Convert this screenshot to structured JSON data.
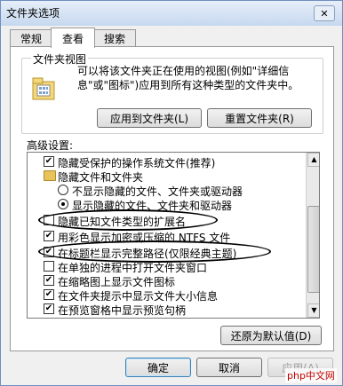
{
  "window": {
    "title": "文件夹选项",
    "close_icon": "close-icon"
  },
  "tabs": [
    {
      "label": "常规",
      "active": false
    },
    {
      "label": "查看",
      "active": true
    },
    {
      "label": "搜索",
      "active": false
    }
  ],
  "folder_views": {
    "title": "文件夹视图",
    "description": "可以将该文件夹正在使用的视图(例如\"详细信息\"或\"图标\")应用到所有这种类型的文件夹中。",
    "apply_button": "应用到文件夹(L)",
    "reset_button": "重置文件夹(R)"
  },
  "advanced": {
    "label": "高级设置:",
    "items": [
      {
        "type": "checkbox",
        "checked": true,
        "label": "隐藏受保护的操作系统文件(推荐)"
      },
      {
        "type": "folder",
        "label": "隐藏文件和文件夹"
      },
      {
        "type": "radio",
        "checked": false,
        "label": "不显示隐藏的文件、文件夹或驱动器"
      },
      {
        "type": "radio",
        "checked": true,
        "label": "显示隐藏的文件、文件夹和驱动器"
      },
      {
        "type": "checkbox",
        "checked": false,
        "label": "隐藏已知文件类型的扩展名"
      },
      {
        "type": "checkbox",
        "checked": true,
        "label": "用彩色显示加密或压缩的 NTFS 文件"
      },
      {
        "type": "checkbox",
        "checked": true,
        "label": "在标题栏显示完整路径(仅限经典主题)"
      },
      {
        "type": "checkbox",
        "checked": false,
        "label": "在单独的进程中打开文件夹窗口"
      },
      {
        "type": "checkbox",
        "checked": true,
        "label": "在缩略图上显示文件图标"
      },
      {
        "type": "checkbox",
        "checked": true,
        "label": "在文件夹提示中显示文件大小信息"
      },
      {
        "type": "checkbox",
        "checked": true,
        "label": "在预览窗格中显示预览句柄"
      }
    ],
    "restore_button": "还原为默认值(D)"
  },
  "footer": {
    "ok": "确定",
    "cancel": "取消",
    "apply": "应用(A)"
  },
  "watermark": "php中文网"
}
